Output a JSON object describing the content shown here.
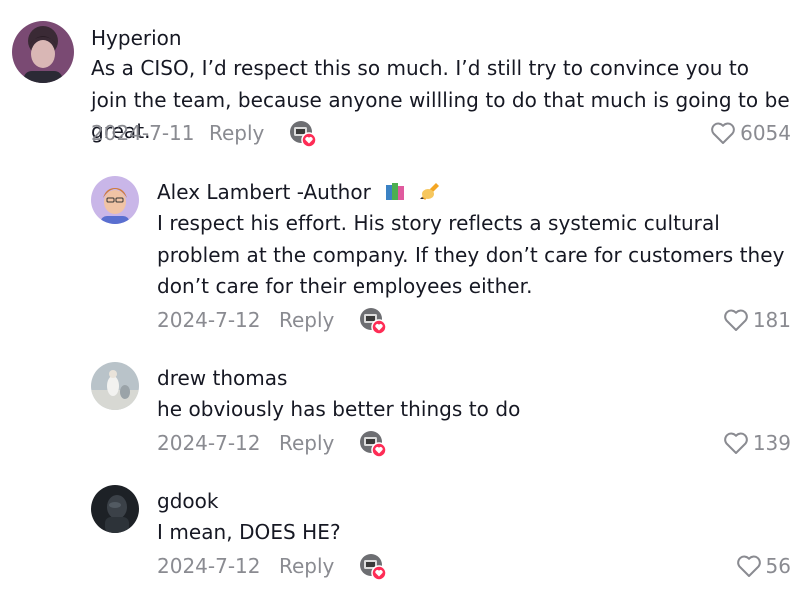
{
  "comments": [
    {
      "username": "Hyperion",
      "text": "As a CISO, I’d respect this so much. I’d still try to convince you to join the team, because anyone willling to do that much is going to be great.",
      "date": "2024-7-11",
      "reply": "Reply",
      "likes": "6054",
      "avatar_icon": "avatar-photo"
    },
    {
      "username": "Alex Lambert -Author",
      "username_badges": [
        "books-icon",
        "writing-hand-icon"
      ],
      "text": "I respect his effort. His story reflects a systemic cultural problem at the company. If they don’t care for customers they don’t care for their employees either.",
      "date": "2024-7-12",
      "reply": "Reply",
      "likes": "181",
      "avatar_icon": "avatar-photo"
    },
    {
      "username": "drew thomas",
      "text": "he obviously has better things to do",
      "date": "2024-7-12",
      "reply": "Reply",
      "likes": "139",
      "avatar_icon": "avatar-photo"
    },
    {
      "username": "gdook",
      "text": "I mean, DOES HE?",
      "date": "2024-7-12",
      "reply": "Reply",
      "likes": "56",
      "avatar_icon": "avatar-photo"
    }
  ],
  "colors": {
    "text": "#161823",
    "secondary": "#8a8b91",
    "heart_badge": "#fe2c55"
  }
}
